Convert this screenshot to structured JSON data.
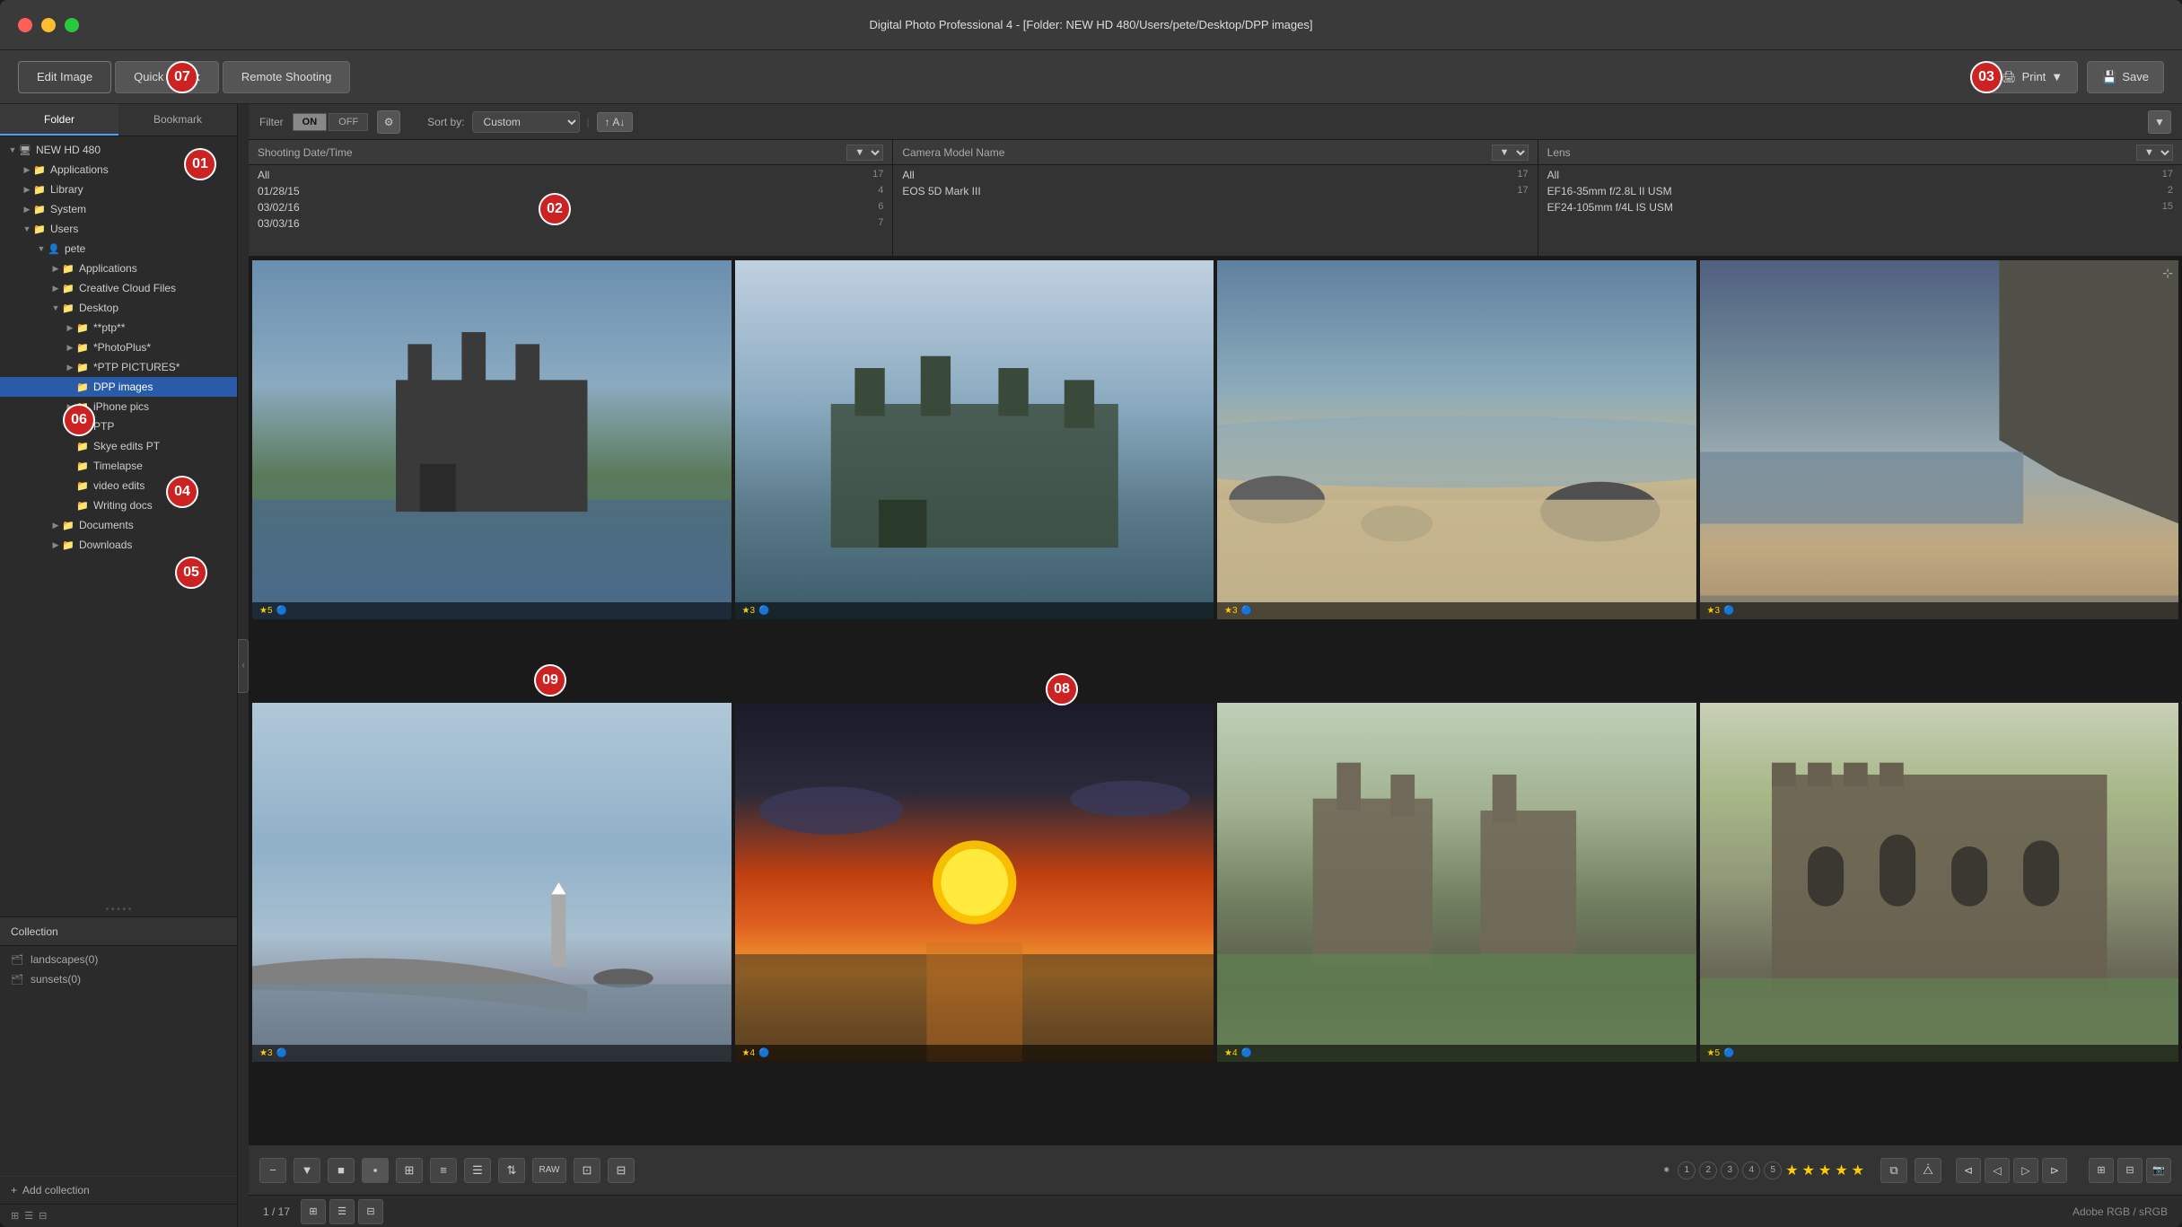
{
  "window": {
    "title": "Digital Photo Professional 4 - [Folder: NEW HD 480/Users/pete/Desktop/DPP images]",
    "traffic_lights": [
      "close",
      "minimize",
      "maximize"
    ]
  },
  "toolbar": {
    "edit_image_label": "Edit Image",
    "quick_check_label": "Quick Check",
    "remote_shooting_label": "Remote Shooting",
    "print_label": "Print",
    "save_label": "Save"
  },
  "sidebar": {
    "folder_tab": "Folder",
    "bookmark_tab": "Bookmark",
    "root_label": "NEW HD 480",
    "tree": [
      {
        "label": "Applications",
        "indent": 1,
        "expanded": false
      },
      {
        "label": "Library",
        "indent": 1,
        "expanded": false
      },
      {
        "label": "System",
        "indent": 1,
        "expanded": false
      },
      {
        "label": "Users",
        "indent": 1,
        "expanded": true
      },
      {
        "label": "pete",
        "indent": 2,
        "expanded": true
      },
      {
        "label": "Applications",
        "indent": 3,
        "expanded": false
      },
      {
        "label": "Creative Cloud Files",
        "indent": 3,
        "expanded": false
      },
      {
        "label": "Desktop",
        "indent": 3,
        "expanded": true
      },
      {
        "label": "**ptp**",
        "indent": 4,
        "expanded": false
      },
      {
        "label": "*PhotoPlus*",
        "indent": 4,
        "expanded": false
      },
      {
        "label": "*PTP PICTURES*",
        "indent": 4,
        "expanded": false
      },
      {
        "label": "DPP images",
        "indent": 4,
        "expanded": false,
        "selected": true
      },
      {
        "label": "iPhone pics",
        "indent": 4,
        "expanded": false
      },
      {
        "label": "PTP",
        "indent": 4,
        "expanded": false
      },
      {
        "label": "Skye edits PT",
        "indent": 4,
        "expanded": false
      },
      {
        "label": "Timelapse",
        "indent": 4,
        "expanded": false
      },
      {
        "label": "video edits",
        "indent": 4,
        "expanded": false
      },
      {
        "label": "Writing docs",
        "indent": 4,
        "expanded": false
      },
      {
        "label": "Documents",
        "indent": 3,
        "expanded": false
      },
      {
        "label": "Downloads",
        "indent": 3,
        "expanded": false
      }
    ]
  },
  "collection": {
    "header": "Collection",
    "items": [
      {
        "label": "landscapes(0)",
        "icon": "📁"
      },
      {
        "label": "sunsets(0)",
        "icon": "📁"
      }
    ],
    "add_label": "+ Add collection"
  },
  "filter_bar": {
    "filter_label": "Filter",
    "on_label": "ON",
    "off_label": "OFF",
    "sort_label": "Sort by:",
    "sort_value": "Custom",
    "sort_direction": "↑ A↓"
  },
  "filter_columns": [
    {
      "header": "Shooting Date/Time",
      "dropdown": "▼",
      "rows": [
        {
          "label": "All",
          "count": "17",
          "selected": false
        },
        {
          "label": "01/28/15",
          "count": "4",
          "selected": false
        },
        {
          "label": "03/02/16",
          "count": "6",
          "selected": false
        },
        {
          "label": "03/03/16",
          "count": "7",
          "selected": false
        }
      ]
    },
    {
      "header": "Camera Model Name",
      "dropdown": "▼",
      "rows": [
        {
          "label": "All",
          "count": "17",
          "selected": false
        },
        {
          "label": "EOS 5D Mark III",
          "count": "17",
          "selected": false
        }
      ]
    },
    {
      "header": "Lens",
      "dropdown": "▼",
      "rows": [
        {
          "label": "All",
          "count": "17",
          "selected": false
        },
        {
          "label": "EF16-35mm f/2.8L II USM",
          "count": "2",
          "selected": false
        },
        {
          "label": "EF24-105mm f/4L IS USM",
          "count": "15",
          "selected": false
        }
      ]
    }
  ],
  "photos": [
    {
      "id": 1,
      "stars": "★5",
      "style": "photo-castle1",
      "has_compare": false
    },
    {
      "id": 2,
      "stars": "★3",
      "style": "photo-castle2",
      "has_compare": false
    },
    {
      "id": 3,
      "stars": "★3",
      "style": "photo-beach1",
      "has_compare": false
    },
    {
      "id": 4,
      "stars": "★3",
      "style": "photo-beach2",
      "has_compare": false
    },
    {
      "id": 5,
      "stars": "★3",
      "style": "photo-pier",
      "has_compare": true
    },
    {
      "id": 6,
      "stars": "★4",
      "style": "photo-sunset",
      "has_compare": false
    },
    {
      "id": 7,
      "stars": "★4",
      "style": "photo-ruins1",
      "has_compare": false
    },
    {
      "id": 8,
      "stars": "★5",
      "style": "photo-ruins2",
      "has_compare": false
    }
  ],
  "bottom_bar": {
    "zoom_out": "−",
    "check_icon": "▼",
    "tools": [
      "■",
      "▪",
      "⊞",
      "≡",
      "☰",
      "RAW",
      "⊡",
      "⊟"
    ],
    "ratings": [
      "1",
      "2",
      "3",
      "4",
      "5"
    ],
    "stars": "★★★★★",
    "nav_icons": [
      "⊲",
      "◁",
      "▷",
      "⊳"
    ]
  },
  "status_bar": {
    "count": "1 / 17",
    "color_space": "Adobe RGB / sRGB"
  },
  "annotations": [
    {
      "id": "01",
      "label": "01"
    },
    {
      "id": "02",
      "label": "02"
    },
    {
      "id": "03",
      "label": "03"
    },
    {
      "id": "04",
      "label": "04"
    },
    {
      "id": "05",
      "label": "05"
    },
    {
      "id": "06",
      "label": "06"
    },
    {
      "id": "07",
      "label": "07"
    },
    {
      "id": "08",
      "label": "08"
    },
    {
      "id": "09",
      "label": "09"
    }
  ]
}
